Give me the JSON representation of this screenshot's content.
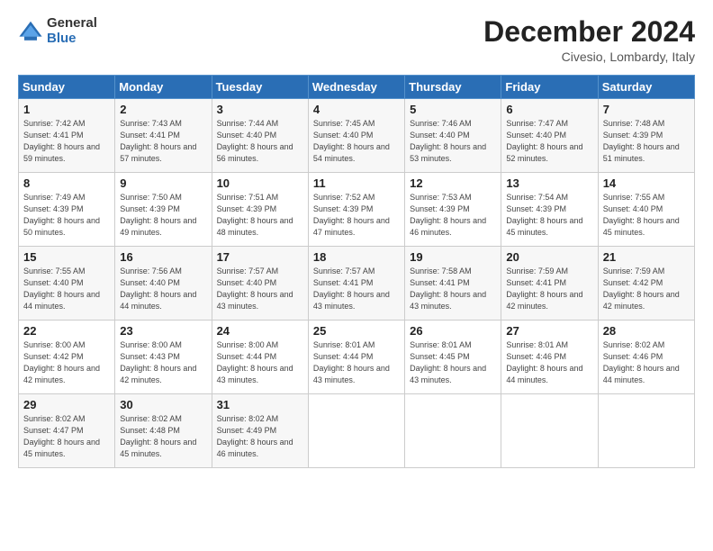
{
  "logo": {
    "general": "General",
    "blue": "Blue"
  },
  "title": "December 2024",
  "location": "Civesio, Lombardy, Italy",
  "weekdays": [
    "Sunday",
    "Monday",
    "Tuesday",
    "Wednesday",
    "Thursday",
    "Friday",
    "Saturday"
  ],
  "weeks": [
    [
      {
        "day": "1",
        "sunrise": "7:42 AM",
        "sunset": "4:41 PM",
        "daylight": "8 hours and 59 minutes."
      },
      {
        "day": "2",
        "sunrise": "7:43 AM",
        "sunset": "4:41 PM",
        "daylight": "8 hours and 57 minutes."
      },
      {
        "day": "3",
        "sunrise": "7:44 AM",
        "sunset": "4:40 PM",
        "daylight": "8 hours and 56 minutes."
      },
      {
        "day": "4",
        "sunrise": "7:45 AM",
        "sunset": "4:40 PM",
        "daylight": "8 hours and 54 minutes."
      },
      {
        "day": "5",
        "sunrise": "7:46 AM",
        "sunset": "4:40 PM",
        "daylight": "8 hours and 53 minutes."
      },
      {
        "day": "6",
        "sunrise": "7:47 AM",
        "sunset": "4:40 PM",
        "daylight": "8 hours and 52 minutes."
      },
      {
        "day": "7",
        "sunrise": "7:48 AM",
        "sunset": "4:39 PM",
        "daylight": "8 hours and 51 minutes."
      }
    ],
    [
      {
        "day": "8",
        "sunrise": "7:49 AM",
        "sunset": "4:39 PM",
        "daylight": "8 hours and 50 minutes."
      },
      {
        "day": "9",
        "sunrise": "7:50 AM",
        "sunset": "4:39 PM",
        "daylight": "8 hours and 49 minutes."
      },
      {
        "day": "10",
        "sunrise": "7:51 AM",
        "sunset": "4:39 PM",
        "daylight": "8 hours and 48 minutes."
      },
      {
        "day": "11",
        "sunrise": "7:52 AM",
        "sunset": "4:39 PM",
        "daylight": "8 hours and 47 minutes."
      },
      {
        "day": "12",
        "sunrise": "7:53 AM",
        "sunset": "4:39 PM",
        "daylight": "8 hours and 46 minutes."
      },
      {
        "day": "13",
        "sunrise": "7:54 AM",
        "sunset": "4:39 PM",
        "daylight": "8 hours and 45 minutes."
      },
      {
        "day": "14",
        "sunrise": "7:55 AM",
        "sunset": "4:40 PM",
        "daylight": "8 hours and 45 minutes."
      }
    ],
    [
      {
        "day": "15",
        "sunrise": "7:55 AM",
        "sunset": "4:40 PM",
        "daylight": "8 hours and 44 minutes."
      },
      {
        "day": "16",
        "sunrise": "7:56 AM",
        "sunset": "4:40 PM",
        "daylight": "8 hours and 44 minutes."
      },
      {
        "day": "17",
        "sunrise": "7:57 AM",
        "sunset": "4:40 PM",
        "daylight": "8 hours and 43 minutes."
      },
      {
        "day": "18",
        "sunrise": "7:57 AM",
        "sunset": "4:41 PM",
        "daylight": "8 hours and 43 minutes."
      },
      {
        "day": "19",
        "sunrise": "7:58 AM",
        "sunset": "4:41 PM",
        "daylight": "8 hours and 43 minutes."
      },
      {
        "day": "20",
        "sunrise": "7:59 AM",
        "sunset": "4:41 PM",
        "daylight": "8 hours and 42 minutes."
      },
      {
        "day": "21",
        "sunrise": "7:59 AM",
        "sunset": "4:42 PM",
        "daylight": "8 hours and 42 minutes."
      }
    ],
    [
      {
        "day": "22",
        "sunrise": "8:00 AM",
        "sunset": "4:42 PM",
        "daylight": "8 hours and 42 minutes."
      },
      {
        "day": "23",
        "sunrise": "8:00 AM",
        "sunset": "4:43 PM",
        "daylight": "8 hours and 42 minutes."
      },
      {
        "day": "24",
        "sunrise": "8:00 AM",
        "sunset": "4:44 PM",
        "daylight": "8 hours and 43 minutes."
      },
      {
        "day": "25",
        "sunrise": "8:01 AM",
        "sunset": "4:44 PM",
        "daylight": "8 hours and 43 minutes."
      },
      {
        "day": "26",
        "sunrise": "8:01 AM",
        "sunset": "4:45 PM",
        "daylight": "8 hours and 43 minutes."
      },
      {
        "day": "27",
        "sunrise": "8:01 AM",
        "sunset": "4:46 PM",
        "daylight": "8 hours and 44 minutes."
      },
      {
        "day": "28",
        "sunrise": "8:02 AM",
        "sunset": "4:46 PM",
        "daylight": "8 hours and 44 minutes."
      }
    ],
    [
      {
        "day": "29",
        "sunrise": "8:02 AM",
        "sunset": "4:47 PM",
        "daylight": "8 hours and 45 minutes."
      },
      {
        "day": "30",
        "sunrise": "8:02 AM",
        "sunset": "4:48 PM",
        "daylight": "8 hours and 45 minutes."
      },
      {
        "day": "31",
        "sunrise": "8:02 AM",
        "sunset": "4:49 PM",
        "daylight": "8 hours and 46 minutes."
      },
      null,
      null,
      null,
      null
    ]
  ],
  "labels": {
    "sunrise": "Sunrise:",
    "sunset": "Sunset:",
    "daylight": "Daylight:"
  }
}
